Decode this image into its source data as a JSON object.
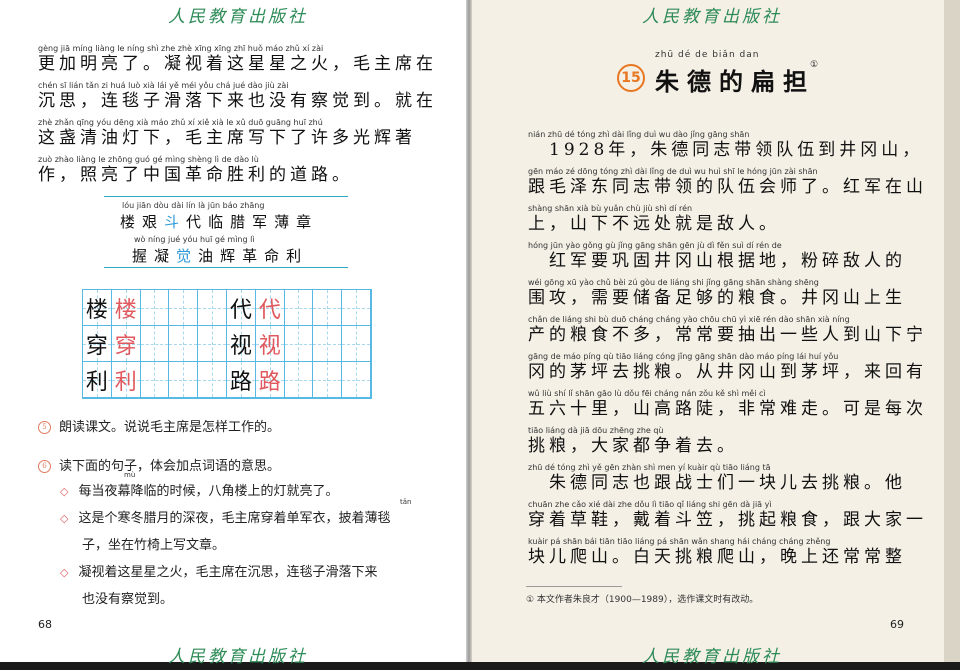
{
  "publisher_logo": "人民教育出版社",
  "left_page": {
    "text_lines": [
      {
        "py": "gèng jiā míng liàng le        níng shì  zhe  zhè xīng xīng zhī huǒ        máo zhǔ  xí   zài",
        "hz": "更加明亮了。凝视着这星星之火，毛主席在"
      },
      {
        "py": "chén  sī          lián  tǎn  zi   huá  luò  xià   lái  yě   méi  yǒu  chá  jué  dào         jiù  zài",
        "hz": "沉思，连毯子滑落下来也没有察觉到。就在"
      },
      {
        "py": "zhè zhǎn qīng yóu dēng xià       máo  zhǔ  xí   xiě  xià   le   xǔ  duō guāng huī  zhú",
        "hz": "这盏清油灯下，毛主席写下了许多光辉著"
      },
      {
        "py": "zuò         zhào liàng  le zhōng guó   gé  mìng shèng  lì    de  dào  lù",
        "hz": "作，照亮了中国革命胜利的道路。"
      }
    ],
    "vocab": {
      "row1_py": "lóu   jiān   dòu   dài   lín   là   jūn   báo zhāng",
      "row1_hz": [
        "楼",
        "艰",
        "斗",
        "代",
        "临",
        "腊",
        "军",
        "薄",
        "章"
      ],
      "row2_py": "wò  níng   jué   yóu   huī   gé  mìng   lì",
      "row2_hz": [
        "握",
        "凝",
        "觉",
        "油",
        "辉",
        "革",
        "命",
        "利"
      ]
    },
    "grid": [
      [
        "楼",
        "楼",
        "",
        "",
        "",
        "代",
        "代",
        "",
        "",
        ""
      ],
      [
        "穿",
        "穿",
        "",
        "",
        "",
        "视",
        "视",
        "",
        "",
        ""
      ],
      [
        "利",
        "利",
        "",
        "",
        "",
        "路",
        "路",
        "",
        "",
        ""
      ]
    ],
    "exercise1": "朗读课文。说说毛主席是怎样工作的。",
    "exercise2": "读下面的句子，体会加点词语的意思。",
    "sentences": [
      {
        "text": "每当夜幕降临的时候，八角楼上的灯就亮了。",
        "py": "mù"
      },
      {
        "text": "这是个寒冬腊月的深夜，毛主席穿着单军衣，披着薄毯",
        "py": "tǎn"
      },
      {
        "text": "子，坐在竹椅上写文章。",
        "py": ""
      },
      {
        "text": "凝视着这星星之火，毛主席在沉思，连毯子滑落下来",
        "py": ""
      },
      {
        "text": "也没有察觉到。",
        "py": ""
      }
    ],
    "exercise_icons": [
      "5",
      "6"
    ],
    "page_number": "68"
  },
  "right_page": {
    "lesson_number": "15",
    "title_py": "zhū    dé    de   biǎn  dan",
    "title": "朱德的扁担",
    "title_note_mark": "①",
    "text_lines": [
      {
        "py": "nián        zhū  dé  tóng  zhì  dài  lǐng  duì   wu  dào  jǐng gāng shān",
        "hz": "　1928年，朱德同志带领队伍到井冈山，"
      },
      {
        "py": "gēn máo zé dōng tóng  zhì  dài  lǐng  de  duì   wu  huì  shī   le        hóng jūn  zài shān",
        "hz": "跟毛泽东同志带领的队伍会师了。红军在山"
      },
      {
        "py": "shàng       shān  xià  bù  yuǎn  chù  jiù  shì  dí   rén",
        "hz": "上，山下不远处就是敌人。"
      },
      {
        "py": "hóng jūn yào gǒng gù jǐng gāng shān gēn  jù  dì        fěn  suì  dí  rén  de",
        "hz": "　红军要巩固井冈山根据地，粉碎敌人的"
      },
      {
        "py": "wéi gōng       xū  yào chǔ  bèi  zú  gòu  de liáng shi       jǐng gāng shān shàng shēng",
        "hz": "围攻，需要储备足够的粮食。井冈山上生"
      },
      {
        "py": "chǎn de liáng shi  bù  duō       cháng cháng yào chōu chū  yì   xiē  rén  dào  shān xià níng",
        "hz": "产的粮食不多，常常要抽出一些人到山下宁"
      },
      {
        "py": "gāng de  máo píng qù  tiāo liáng      cóng jǐng gāng shān dào máo píng       lái  huí  yǒu",
        "hz": "冈的茅坪去挑粮。从井冈山到茅坪，来回有"
      },
      {
        "py": "wǔ  liù  shí  lǐ        shān gāo  lù  dǒu        fēi cháng nán zǒu        kě  shì měi  cì",
        "hz": "五六十里，山高路陡，非常难走。可是每次"
      },
      {
        "py": "tiāo liáng      dà  jiā  dōu zhēng zhe  qù",
        "hz": "挑粮，大家都争着去。"
      },
      {
        "py": "zhū  dé  tóng  zhì  yě  gēn zhàn shì men  yí  kuàir   qù  tiāo liáng     tā",
        "hz": "　朱德同志也跟战士们一块儿去挑粮。他"
      },
      {
        "py": "chuān zhe  cǎo  xié        dài  zhe  dǒu  lì        tiāo  qǐ liáng shi        gēn  dà  jiā  yì",
        "hz": "穿着草鞋，戴着斗笠，挑起粮食，跟大家一"
      },
      {
        "py": "kuàir  pá shān     bái  tiān tiāo liáng pá  shān       wǎn shang hái cháng cháng zhěng",
        "hz": "块儿爬山。白天挑粮爬山，晚上还常常整"
      }
    ],
    "footnote": "① 本文作者朱良才（1900—1989），选作课文时有改动。",
    "page_number": "69"
  }
}
